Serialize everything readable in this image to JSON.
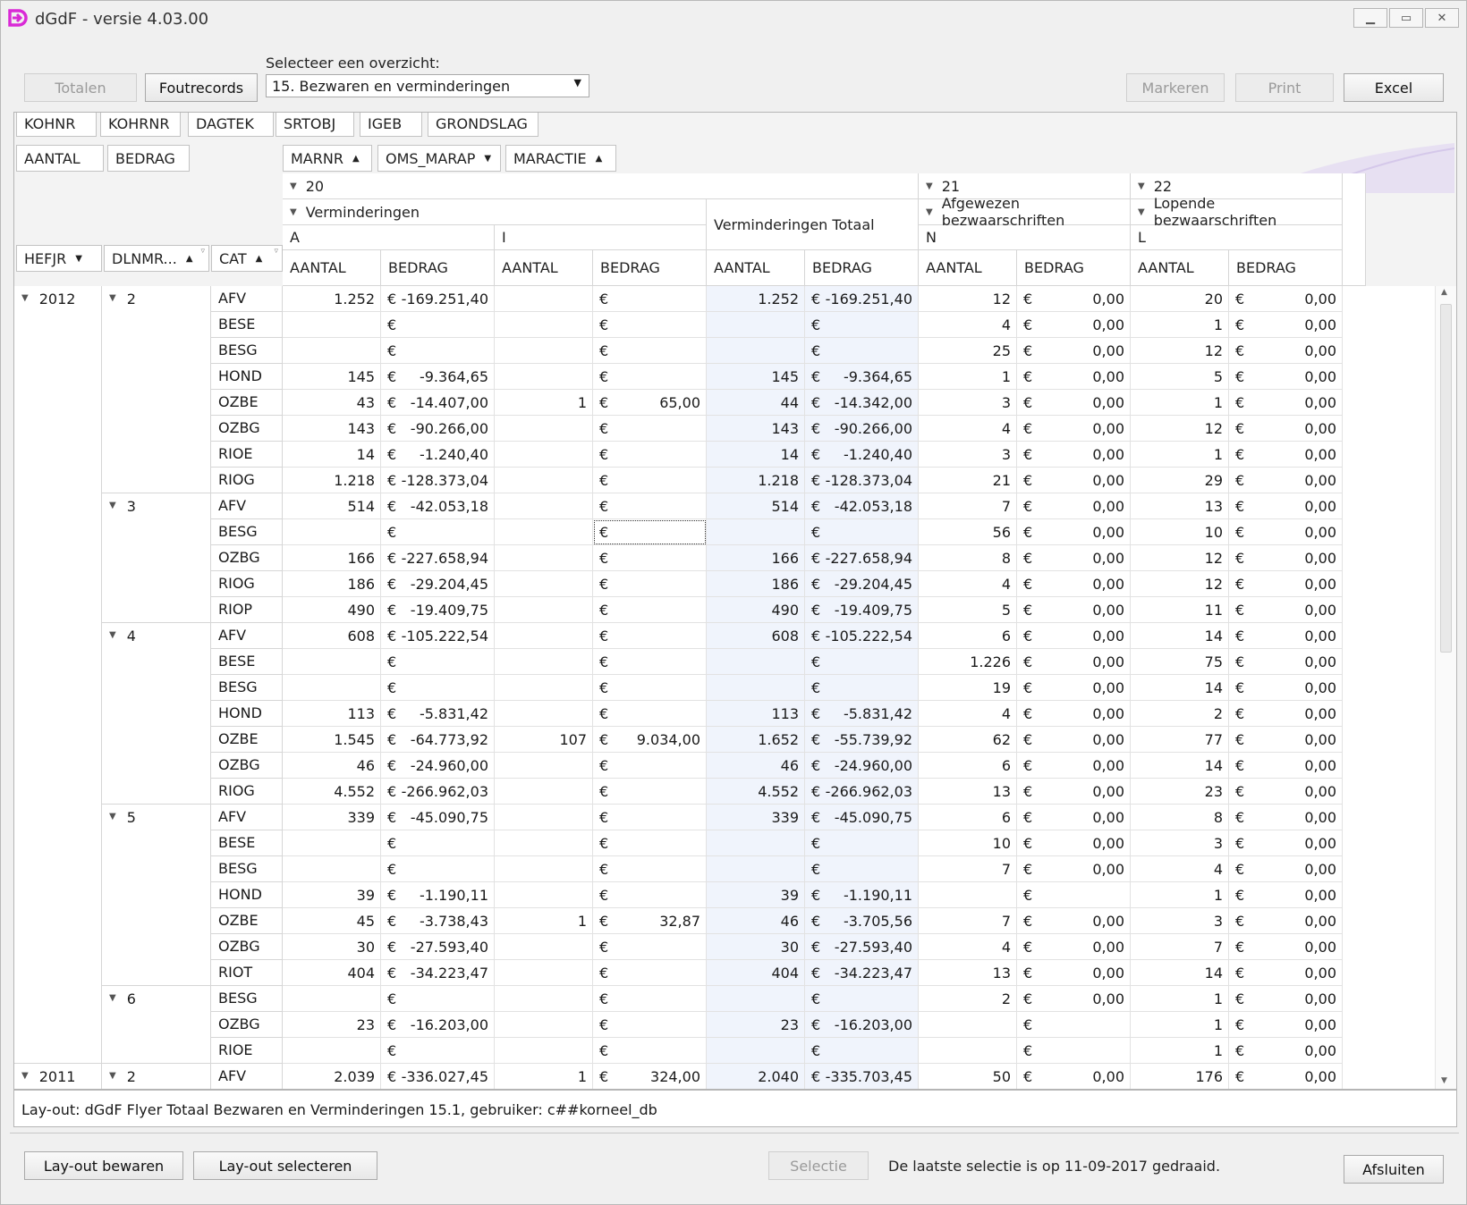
{
  "window": {
    "title": "dGdF - versie 4.03.00",
    "minimize": "▁",
    "maximize": "▭",
    "close": "✕"
  },
  "toolbar": {
    "totalen": "Totalen",
    "foutrecords": "Foutrecords",
    "select_label": "Selecteer een overzicht:",
    "selected": "15.  Bezwaren en verminderingen",
    "markeren": "Markeren",
    "print": "Print",
    "excel": "Excel"
  },
  "filter_fields": [
    "KOHNR",
    "KOHRNR",
    "DAGTEK",
    "SRTOBJ",
    "IGEB",
    "GRONDSLAG"
  ],
  "data_fields": [
    "AANTAL",
    "BEDRAG"
  ],
  "column_fields": [
    "MARNR",
    "OMS_MARAP",
    "MARACTIE"
  ],
  "row_fields": [
    "HEFJR",
    "DLNMR...",
    "CAT"
  ],
  "col_headers": {
    "g20": "20",
    "g21": "21",
    "g22": "22",
    "verm": "Verminderingen",
    "verm_tot": "Verminderingen Totaal",
    "afg": "Afgewezen bezwaarschriften",
    "lop": "Lopende bezwaarschriften",
    "a": "A",
    "i": "I",
    "n": "N",
    "l": "L",
    "aantal": "AANTAL",
    "bedrag": "BEDRAG"
  },
  "euro": "€",
  "rows": [
    {
      "y": "2012",
      "d": "2",
      "c": "AFV",
      "aA": "1.252",
      "aB": "-169.251,40",
      "iA": "",
      "iB": "",
      "tA": "1.252",
      "tB": "-169.251,40",
      "nA": "12",
      "nB": "0,00",
      "lA": "20",
      "lB": "0,00"
    },
    {
      "c": "BESE",
      "aA": "",
      "aB": "",
      "iA": "",
      "iB": "",
      "tA": "",
      "tB": "",
      "nA": "4",
      "nB": "0,00",
      "lA": "1",
      "lB": "0,00"
    },
    {
      "c": "BESG",
      "aA": "",
      "aB": "",
      "iA": "",
      "iB": "",
      "tA": "",
      "tB": "",
      "nA": "25",
      "nB": "0,00",
      "lA": "12",
      "lB": "0,00"
    },
    {
      "c": "HOND",
      "aA": "145",
      "aB": "-9.364,65",
      "iA": "",
      "iB": "",
      "tA": "145",
      "tB": "-9.364,65",
      "nA": "1",
      "nB": "0,00",
      "lA": "5",
      "lB": "0,00"
    },
    {
      "c": "OZBE",
      "aA": "43",
      "aB": "-14.407,00",
      "iA": "1",
      "iB": "65,00",
      "tA": "44",
      "tB": "-14.342,00",
      "nA": "3",
      "nB": "0,00",
      "lA": "1",
      "lB": "0,00"
    },
    {
      "c": "OZBG",
      "aA": "143",
      "aB": "-90.266,00",
      "iA": "",
      "iB": "",
      "tA": "143",
      "tB": "-90.266,00",
      "nA": "4",
      "nB": "0,00",
      "lA": "12",
      "lB": "0,00"
    },
    {
      "c": "RIOE",
      "aA": "14",
      "aB": "-1.240,40",
      "iA": "",
      "iB": "",
      "tA": "14",
      "tB": "-1.240,40",
      "nA": "3",
      "nB": "0,00",
      "lA": "1",
      "lB": "0,00"
    },
    {
      "c": "RIOG",
      "aA": "1.218",
      "aB": "-128.373,04",
      "iA": "",
      "iB": "",
      "tA": "1.218",
      "tB": "-128.373,04",
      "nA": "21",
      "nB": "0,00",
      "lA": "29",
      "lB": "0,00"
    },
    {
      "d": "3",
      "c": "AFV",
      "aA": "514",
      "aB": "-42.053,18",
      "iA": "",
      "iB": "",
      "tA": "514",
      "tB": "-42.053,18",
      "nA": "7",
      "nB": "0,00",
      "lA": "13",
      "lB": "0,00"
    },
    {
      "c": "BESG",
      "aA": "",
      "aB": "",
      "iA": "",
      "iB": "",
      "tA": "",
      "tB": "",
      "nA": "56",
      "nB": "0,00",
      "lA": "10",
      "lB": "0,00",
      "focus": true
    },
    {
      "c": "OZBG",
      "aA": "166",
      "aB": "-227.658,94",
      "iA": "",
      "iB": "",
      "tA": "166",
      "tB": "-227.658,94",
      "nA": "8",
      "nB": "0,00",
      "lA": "12",
      "lB": "0,00"
    },
    {
      "c": "RIOG",
      "aA": "186",
      "aB": "-29.204,45",
      "iA": "",
      "iB": "",
      "tA": "186",
      "tB": "-29.204,45",
      "nA": "4",
      "nB": "0,00",
      "lA": "12",
      "lB": "0,00"
    },
    {
      "c": "RIOP",
      "aA": "490",
      "aB": "-19.409,75",
      "iA": "",
      "iB": "",
      "tA": "490",
      "tB": "-19.409,75",
      "nA": "5",
      "nB": "0,00",
      "lA": "11",
      "lB": "0,00"
    },
    {
      "d": "4",
      "c": "AFV",
      "aA": "608",
      "aB": "-105.222,54",
      "iA": "",
      "iB": "",
      "tA": "608",
      "tB": "-105.222,54",
      "nA": "6",
      "nB": "0,00",
      "lA": "14",
      "lB": "0,00"
    },
    {
      "c": "BESE",
      "aA": "",
      "aB": "",
      "iA": "",
      "iB": "",
      "tA": "",
      "tB": "",
      "nA": "1.226",
      "nB": "0,00",
      "lA": "75",
      "lB": "0,00"
    },
    {
      "c": "BESG",
      "aA": "",
      "aB": "",
      "iA": "",
      "iB": "",
      "tA": "",
      "tB": "",
      "nA": "19",
      "nB": "0,00",
      "lA": "14",
      "lB": "0,00"
    },
    {
      "c": "HOND",
      "aA": "113",
      "aB": "-5.831,42",
      "iA": "",
      "iB": "",
      "tA": "113",
      "tB": "-5.831,42",
      "nA": "4",
      "nB": "0,00",
      "lA": "2",
      "lB": "0,00"
    },
    {
      "c": "OZBE",
      "aA": "1.545",
      "aB": "-64.773,92",
      "iA": "107",
      "iB": "9.034,00",
      "tA": "1.652",
      "tB": "-55.739,92",
      "nA": "62",
      "nB": "0,00",
      "lA": "77",
      "lB": "0,00"
    },
    {
      "c": "OZBG",
      "aA": "46",
      "aB": "-24.960,00",
      "iA": "",
      "iB": "",
      "tA": "46",
      "tB": "-24.960,00",
      "nA": "6",
      "nB": "0,00",
      "lA": "14",
      "lB": "0,00"
    },
    {
      "c": "RIOG",
      "aA": "4.552",
      "aB": "-266.962,03",
      "iA": "",
      "iB": "",
      "tA": "4.552",
      "tB": "-266.962,03",
      "nA": "13",
      "nB": "0,00",
      "lA": "23",
      "lB": "0,00"
    },
    {
      "d": "5",
      "c": "AFV",
      "aA": "339",
      "aB": "-45.090,75",
      "iA": "",
      "iB": "",
      "tA": "339",
      "tB": "-45.090,75",
      "nA": "6",
      "nB": "0,00",
      "lA": "8",
      "lB": "0,00"
    },
    {
      "c": "BESE",
      "aA": "",
      "aB": "",
      "iA": "",
      "iB": "",
      "tA": "",
      "tB": "",
      "nA": "10",
      "nB": "0,00",
      "lA": "3",
      "lB": "0,00"
    },
    {
      "c": "BESG",
      "aA": "",
      "aB": "",
      "iA": "",
      "iB": "",
      "tA": "",
      "tB": "",
      "nA": "7",
      "nB": "0,00",
      "lA": "4",
      "lB": "0,00"
    },
    {
      "c": "HOND",
      "aA": "39",
      "aB": "-1.190,11",
      "iA": "",
      "iB": "",
      "tA": "39",
      "tB": "-1.190,11",
      "nA": "",
      "nB": "",
      "lA": "1",
      "lB": "0,00"
    },
    {
      "c": "OZBE",
      "aA": "45",
      "aB": "-3.738,43",
      "iA": "1",
      "iB": "32,87",
      "tA": "46",
      "tB": "-3.705,56",
      "nA": "7",
      "nB": "0,00",
      "lA": "3",
      "lB": "0,00"
    },
    {
      "c": "OZBG",
      "aA": "30",
      "aB": "-27.593,40",
      "iA": "",
      "iB": "",
      "tA": "30",
      "tB": "-27.593,40",
      "nA": "4",
      "nB": "0,00",
      "lA": "7",
      "lB": "0,00"
    },
    {
      "c": "RIOT",
      "aA": "404",
      "aB": "-34.223,47",
      "iA": "",
      "iB": "",
      "tA": "404",
      "tB": "-34.223,47",
      "nA": "13",
      "nB": "0,00",
      "lA": "14",
      "lB": "0,00"
    },
    {
      "d": "6",
      "c": "BESG",
      "aA": "",
      "aB": "",
      "iA": "",
      "iB": "",
      "tA": "",
      "tB": "",
      "nA": "2",
      "nB": "0,00",
      "lA": "1",
      "lB": "0,00"
    },
    {
      "c": "OZBG",
      "aA": "23",
      "aB": "-16.203,00",
      "iA": "",
      "iB": "",
      "tA": "23",
      "tB": "-16.203,00",
      "nA": "",
      "nB": "",
      "lA": "1",
      "lB": "0,00"
    },
    {
      "c": "RIOE",
      "aA": "",
      "aB": "",
      "iA": "",
      "iB": "",
      "tA": "",
      "tB": "",
      "nA": "",
      "nB": "",
      "lA": "1",
      "lB": "0,00"
    },
    {
      "y": "2011",
      "d": "2",
      "c": "AFV",
      "aA": "2.039",
      "aB": "-336.027,45",
      "iA": "1",
      "iB": "324,00",
      "tA": "2.040",
      "tB": "-335.703,45",
      "nA": "50",
      "nB": "0,00",
      "lA": "176",
      "lB": "0,00"
    }
  ],
  "layout_info": "Lay-out: dGdF Flyer Totaal Bezwaren en Verminderingen 15.1, gebruiker: c##korneel_db",
  "footer": {
    "bewaren": "Lay-out bewaren",
    "selecteren": "Lay-out selecteren",
    "selectie": "Selectie",
    "status": "De laatste selectie is op 11-09-2017 gedraaid.",
    "afsluiten": "Afsluiten"
  }
}
